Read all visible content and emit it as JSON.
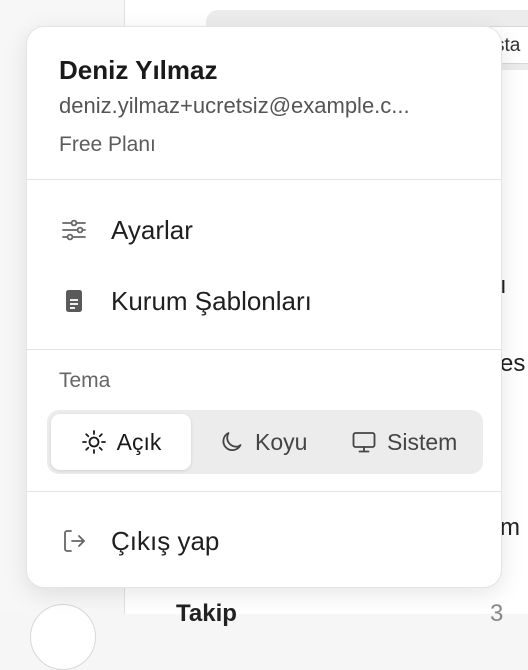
{
  "background": {
    "pill_text": "sta",
    "fragments": [
      "ı",
      "es",
      "m",
      "Takip",
      "3"
    ]
  },
  "menu": {
    "user": {
      "name": "Deniz Yılmaz",
      "email": "deniz.yilmaz+ucretsiz@example.c...",
      "plan": "Free Planı"
    },
    "items": [
      {
        "label": "Ayarlar",
        "icon": "sliders-icon"
      },
      {
        "label": "Kurum Şablonları",
        "icon": "document-icon"
      }
    ],
    "theme": {
      "title": "Tema",
      "options": [
        {
          "label": "Açık",
          "icon": "sun-icon",
          "selected": true
        },
        {
          "label": "Koyu",
          "icon": "moon-icon",
          "selected": false
        },
        {
          "label": "Sistem",
          "icon": "monitor-icon",
          "selected": false
        }
      ]
    },
    "logout": {
      "label": "Çıkış yap",
      "icon": "logout-icon"
    }
  },
  "colors": {
    "popover_bg": "#ffffff",
    "theme_group_bg": "#ececec",
    "text": "#1f1f1f",
    "muted": "#555555"
  }
}
